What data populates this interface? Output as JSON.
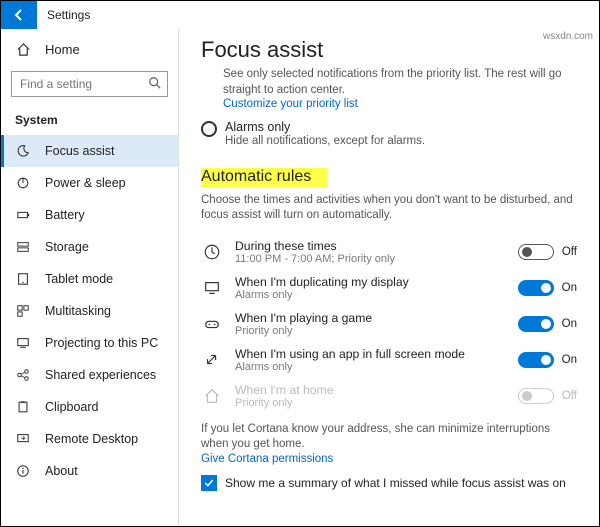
{
  "window": {
    "title": "Settings"
  },
  "sidebar": {
    "home": "Home",
    "search_placeholder": "Find a setting",
    "section": "System",
    "items": [
      {
        "label": "Focus assist"
      },
      {
        "label": "Power & sleep"
      },
      {
        "label": "Battery"
      },
      {
        "label": "Storage"
      },
      {
        "label": "Tablet mode"
      },
      {
        "label": "Multitasking"
      },
      {
        "label": "Projecting to this PC"
      },
      {
        "label": "Shared experiences"
      },
      {
        "label": "Clipboard"
      },
      {
        "label": "Remote Desktop"
      },
      {
        "label": "About"
      }
    ]
  },
  "main": {
    "title": "Focus assist",
    "priority_desc": "See only selected notifications from the priority list. The rest will go straight to action center.",
    "customize_link": "Customize your priority list",
    "alarms_title": "Alarms only",
    "alarms_desc": "Hide all notifications, except for alarms.",
    "auto_title": "Automatic rules",
    "auto_desc": "Choose the times and activities when you don't want to be disturbed, and focus assist will turn on automatically.",
    "rules": [
      {
        "title": "During these times",
        "sub": "11:00 PM - 7:00 AM; Priority only",
        "state": "Off",
        "on": false,
        "disabled": false
      },
      {
        "title": "When I'm duplicating my display",
        "sub": "Alarms only",
        "state": "On",
        "on": true,
        "disabled": false
      },
      {
        "title": "When I'm playing a game",
        "sub": "Priority only",
        "state": "On",
        "on": true,
        "disabled": false
      },
      {
        "title": "When I'm using an app in full screen mode",
        "sub": "Alarms only",
        "state": "On",
        "on": true,
        "disabled": false
      },
      {
        "title": "When I'm at home",
        "sub": "Priority only",
        "state": "Off",
        "on": false,
        "disabled": true
      }
    ],
    "cortana_note": "If you let Cortana know your address, she can minimize interruptions when you get home.",
    "cortana_link": "Give Cortana permissions",
    "summary_checkbox": "Show me a summary of what I missed while focus assist was on"
  },
  "watermark": "wsxdn.com"
}
